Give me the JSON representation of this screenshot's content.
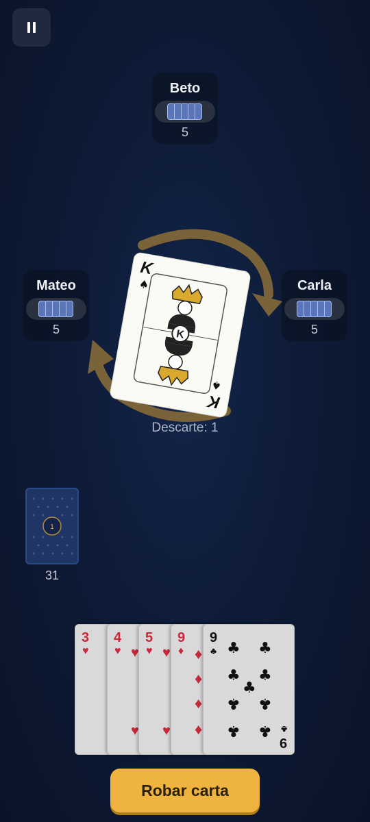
{
  "opponents": {
    "top": {
      "name": "Beto",
      "count": "5"
    },
    "left": {
      "name": "Mateo",
      "count": "5"
    },
    "right": {
      "name": "Carla",
      "count": "5"
    }
  },
  "discard": {
    "label": "Descarte: 1",
    "top_card": {
      "rank": "K",
      "suit": "♠",
      "center_badge": "K"
    }
  },
  "direction": "clockwise",
  "deck": {
    "badge": "1",
    "count": "31"
  },
  "hand": [
    {
      "rank": "3",
      "suit": "♥",
      "color": "red"
    },
    {
      "rank": "4",
      "suit": "♥",
      "color": "red"
    },
    {
      "rank": "5",
      "suit": "♥",
      "color": "red"
    },
    {
      "rank": "9",
      "suit": "♦",
      "color": "red"
    },
    {
      "rank": "9",
      "suit": "♣",
      "color": "black"
    }
  ],
  "actions": {
    "draw_label": "Robar carta"
  },
  "colors": {
    "accent": "#efb440",
    "arrow": "#7a6338",
    "card_back": "#1e3566"
  }
}
